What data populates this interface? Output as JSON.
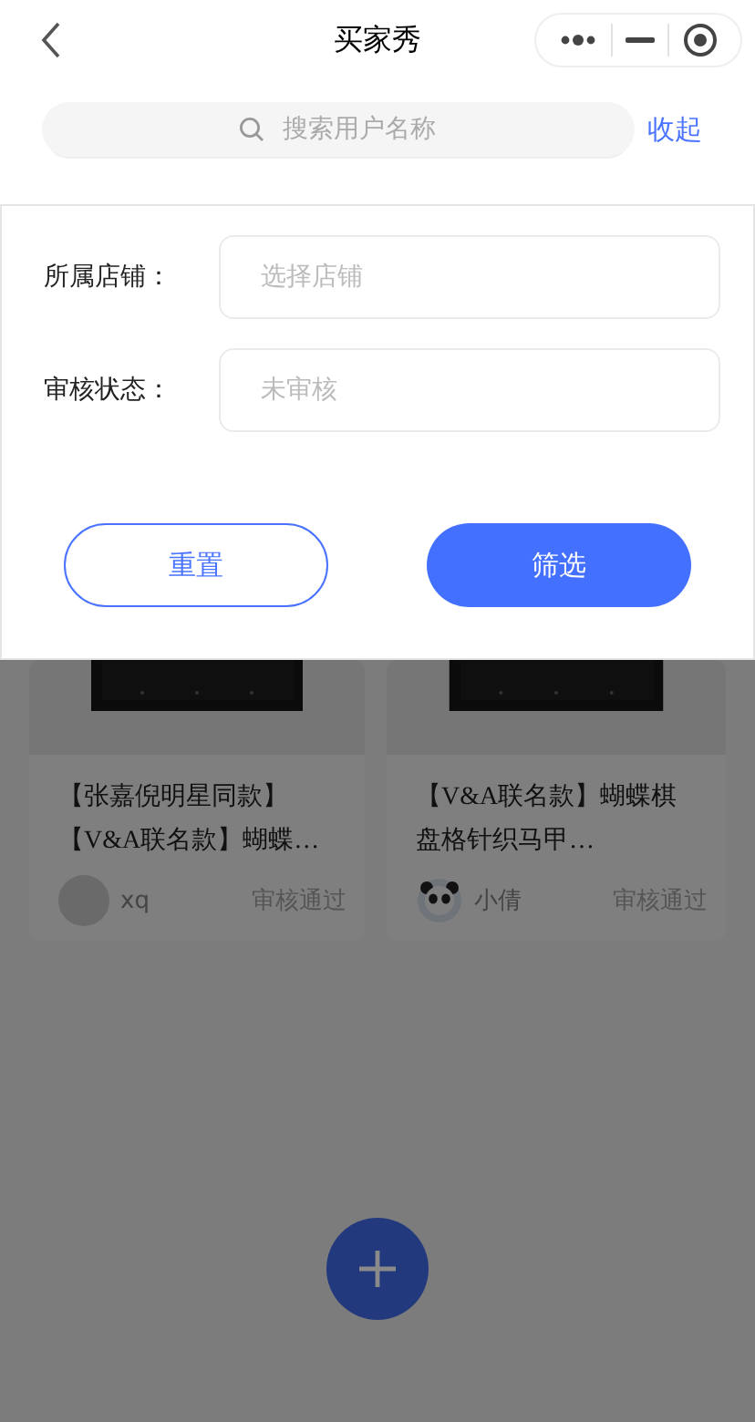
{
  "nav": {
    "title": "买家秀"
  },
  "search": {
    "placeholder": "搜索用户名称"
  },
  "collapse_link": "收起",
  "filter": {
    "fields": [
      {
        "label": "所属店铺：",
        "placeholder": "选择店铺"
      },
      {
        "label": "审核状态：",
        "placeholder": "未审核"
      }
    ],
    "buttons": [
      {
        "label": "重置",
        "kind": "outline"
      },
      {
        "label": "筛选",
        "kind": "primary"
      }
    ]
  },
  "posts": [
    {
      "title_lines": [
        "【张嘉倪明星同款】",
        "【V&A联名款】蝴蝶…"
      ],
      "user": "xq",
      "avatar": {
        "kind": "plain"
      },
      "status": "审核通过"
    },
    {
      "title_lines": [
        "【V&A联名款】蝴蝶棋",
        "盘格针织马甲…"
      ],
      "user": "小倩",
      "status": "审核通过"
    }
  ]
}
